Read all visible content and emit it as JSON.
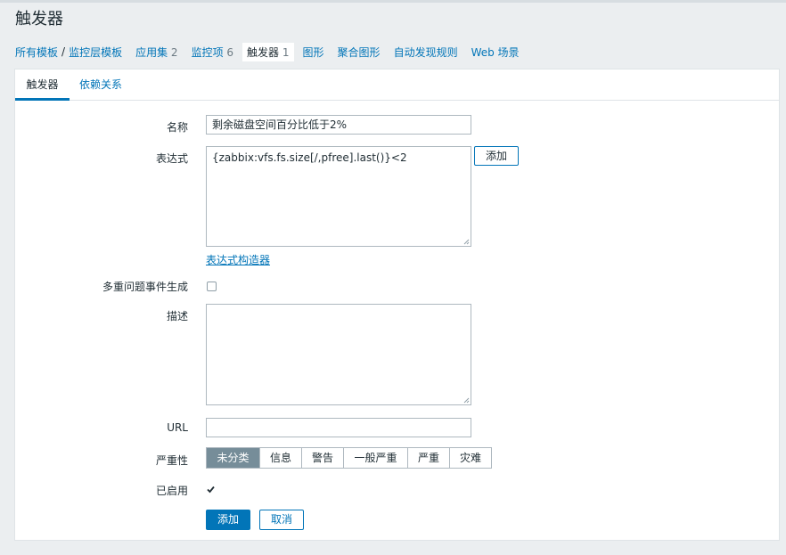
{
  "page": {
    "title": "触发器"
  },
  "breadcrumb": {
    "all_templates": "所有模板",
    "separator": "/",
    "template": "监控层模板",
    "app_sets": {
      "label": "应用集",
      "count": "2"
    },
    "items": {
      "label": "监控项",
      "count": "6"
    },
    "triggers": {
      "label": "触发器",
      "count": "1"
    },
    "graphs": "图形",
    "screens": "聚合图形",
    "discovery": "自动发现规则",
    "web": "Web 场景"
  },
  "tabs": {
    "trigger": "触发器",
    "dependencies": "依赖关系"
  },
  "form": {
    "name_label": "名称",
    "name_value": "剩余磁盘空间百分比低于2%",
    "expression_label": "表达式",
    "expression_value": "{zabbix:vfs.fs.size[/,pfree].last()}<2",
    "add_expression_button": "添加",
    "expression_builder_link": "表达式构造器",
    "multiple_events_label": "多重问题事件生成",
    "multiple_events_checked": false,
    "description_label": "描述",
    "description_value": "",
    "url_label": "URL",
    "url_value": "",
    "severity_label": "严重性",
    "severity_options": [
      "未分类",
      "信息",
      "警告",
      "一般严重",
      "严重",
      "灾难"
    ],
    "severity_selected": "未分类",
    "enabled_label": "已启用",
    "enabled_checked": true,
    "submit_button": "添加",
    "cancel_button": "取消"
  },
  "colors": {
    "accent": "#0275b8",
    "background": "#ebeef0",
    "selected_severity": "#768d99"
  }
}
